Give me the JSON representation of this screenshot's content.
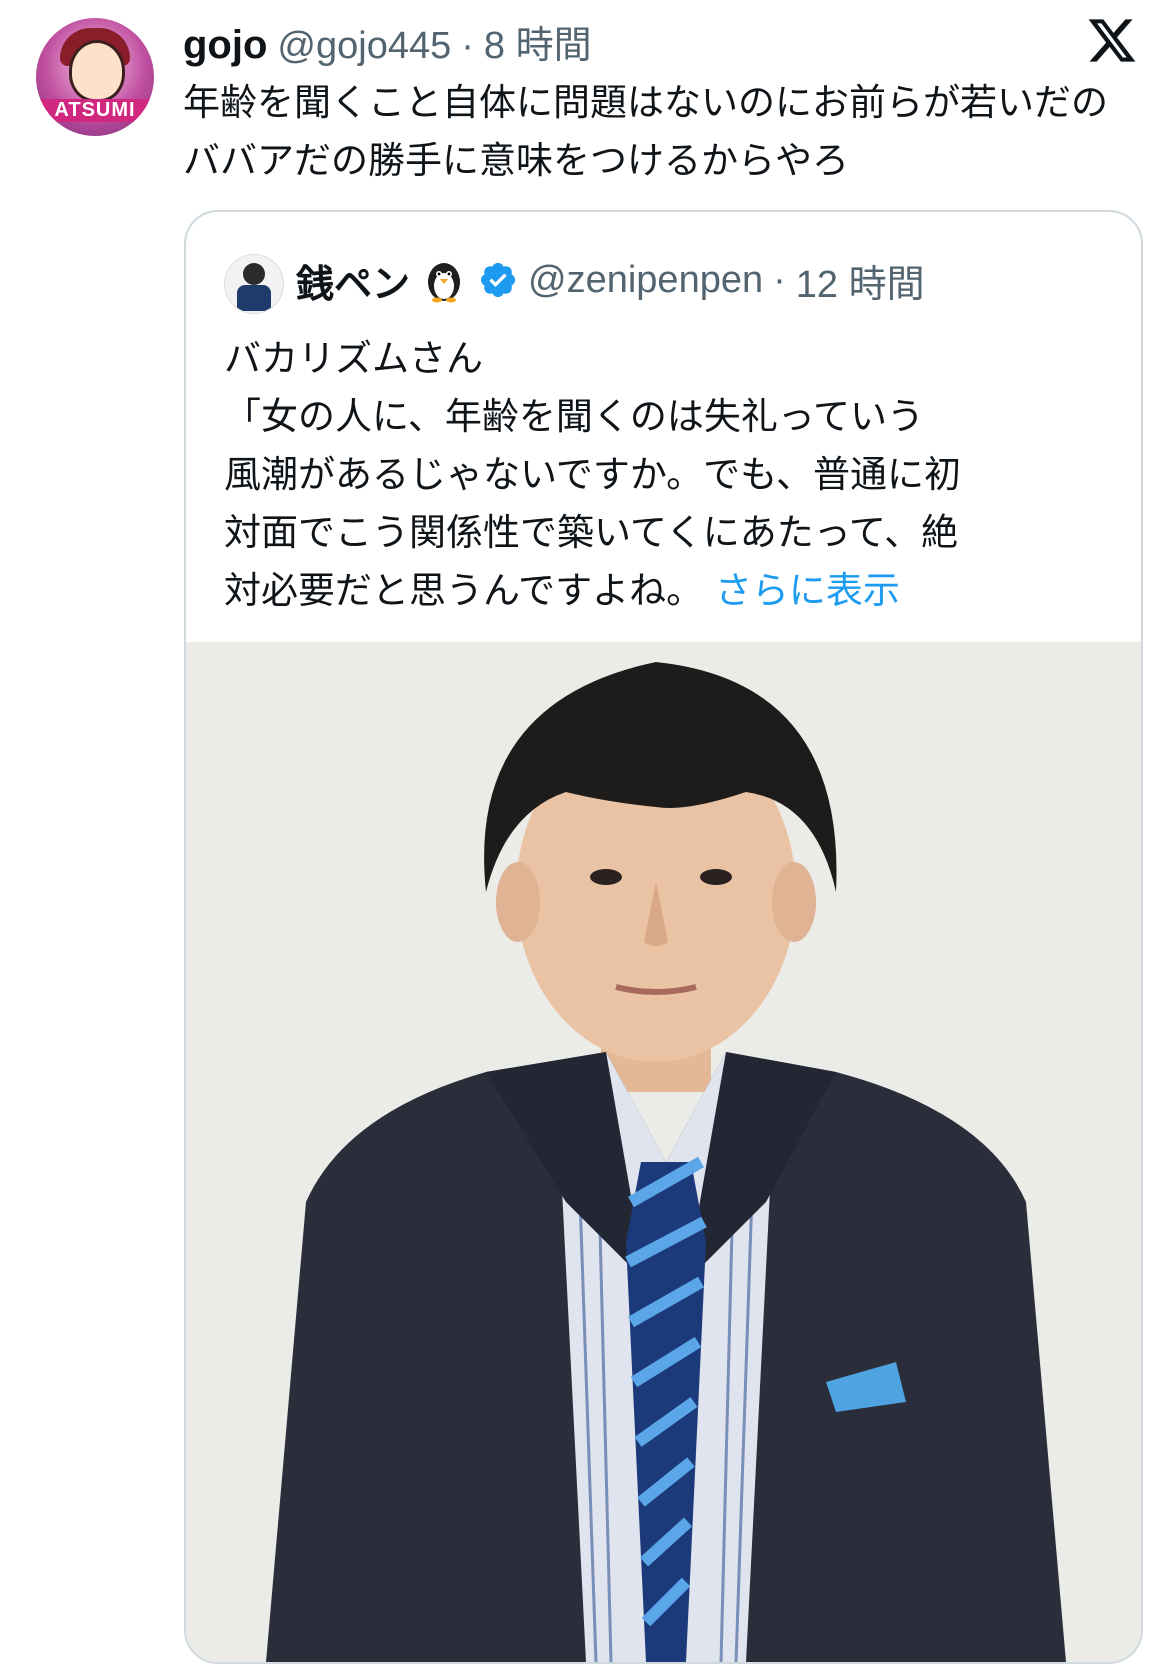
{
  "tweet": {
    "display_name": "gojo",
    "handle": "@gojo445",
    "separator": "·",
    "time": "8 時間",
    "text": "年齢を聞くこと自体に問題はないのにお前らが若いだのババアだの勝手に意味をつけるからやろ",
    "avatar_text": "ATSUMI"
  },
  "quote": {
    "display_name": "銭ペン",
    "handle": "@zenipenpen",
    "separator": "·",
    "time": "12 時間",
    "text_lines": [
      "バカリズムさん",
      "「女の人に、年齢を聞くのは失礼っていう",
      "風潮があるじゃないですか。でも、普通に初",
      "対面でこう関係性で築いてくにあたって、絶",
      "対必要だと思うんですよね。"
    ],
    "show_more": "さらに表示"
  },
  "colors": {
    "text": "#0f1419",
    "secondary": "#536471",
    "link": "#1d9bf0",
    "border": "#cfd9de"
  },
  "icons": {
    "brand": "x-logo-icon",
    "verified": "verified-badge-icon",
    "emoji": "penguin-emoji"
  }
}
